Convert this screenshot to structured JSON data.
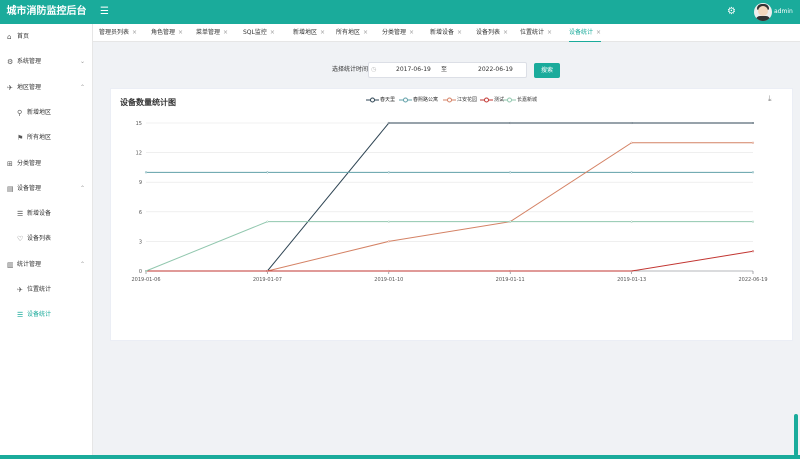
{
  "app": {
    "title": "城市消防监控后台",
    "menu_icon": "☰",
    "settings_icon": "⚙",
    "user_name": "admin"
  },
  "sidebar": {
    "items": [
      {
        "label": "首页",
        "icon": "home-icon",
        "glyph": "⌂",
        "level": 0,
        "expandable": false
      },
      {
        "label": "系统管理",
        "icon": "settings-icon",
        "glyph": "⚙",
        "level": 0,
        "expandable": true,
        "arrow": "⌄"
      },
      {
        "label": "地区管理",
        "icon": "navigation-icon",
        "glyph": "✈",
        "level": 0,
        "expandable": true,
        "arrow": "⌃"
      },
      {
        "label": "新增地区",
        "icon": "location-icon",
        "glyph": "⚲",
        "level": 1
      },
      {
        "label": "所有地区",
        "icon": "flag-icon",
        "glyph": "⚑",
        "level": 1
      },
      {
        "label": "分类管理",
        "icon": "grid-icon",
        "glyph": "⊞",
        "level": 0,
        "expandable": false
      },
      {
        "label": "设备管理",
        "icon": "document-icon",
        "glyph": "▤",
        "level": 0,
        "expandable": true,
        "arrow": "⌃"
      },
      {
        "label": "新增设备",
        "icon": "list-icon",
        "glyph": "☰",
        "level": 1
      },
      {
        "label": "设备列表",
        "icon": "heart-icon",
        "glyph": "♡",
        "level": 1
      },
      {
        "label": "统计管理",
        "icon": "chart-icon",
        "glyph": "▥",
        "level": 0,
        "expandable": true,
        "arrow": "⌃"
      },
      {
        "label": "位置统计",
        "icon": "navigation-icon",
        "glyph": "✈",
        "level": 1
      },
      {
        "label": "设备统计",
        "icon": "list-icon",
        "glyph": "☰",
        "level": 1,
        "active": true
      }
    ]
  },
  "tabs": [
    {
      "label": "管理员列表",
      "close": "×"
    },
    {
      "label": "角色管理",
      "close": "×"
    },
    {
      "label": "菜单管理",
      "close": "×"
    },
    {
      "label": "SQL监控",
      "close": "×"
    },
    {
      "label": "新增地区",
      "close": "×"
    },
    {
      "label": "所有地区",
      "close": "×"
    },
    {
      "label": "分类管理",
      "close": "×"
    },
    {
      "label": "新增设备",
      "close": "×"
    },
    {
      "label": "设备列表",
      "close": "×"
    },
    {
      "label": "位置统计",
      "close": "×"
    },
    {
      "label": "设备统计",
      "close": "×",
      "active": true
    }
  ],
  "filter": {
    "label": "选择统计时间",
    "calendar_icon": "◷",
    "start_date": "2017-06-19",
    "separator": "至",
    "end_date": "2022-06-19",
    "search_label": "搜索"
  },
  "card": {
    "title": "设备数量统计图",
    "download_icon": "⤓"
  },
  "colors": {
    "accent": "#1aab9b"
  },
  "chart_data": {
    "type": "line",
    "title": "设备数量统计图",
    "categories": [
      "2019-01-06",
      "2019-01-07",
      "2019-01-10",
      "2019-01-11",
      "2019-01-13",
      "2022-06-19"
    ],
    "ylim": [
      0,
      15
    ],
    "yticks": [
      0,
      3,
      6,
      9,
      12,
      15
    ],
    "grid": true,
    "legend_position": "top",
    "series": [
      {
        "name": "春天里",
        "color": "#2f4554",
        "values": [
          0,
          0,
          15,
          15,
          15,
          15
        ]
      },
      {
        "name": "春熙路公寓",
        "color": "#61a0a8",
        "values": [
          10,
          10,
          10,
          10,
          10,
          10
        ]
      },
      {
        "name": "江安花园",
        "color": "#d48265",
        "values": [
          0,
          0,
          3,
          5,
          13,
          13
        ]
      },
      {
        "name": "测试",
        "color": "#c23531",
        "values": [
          0,
          0,
          0,
          0,
          0,
          2
        ]
      },
      {
        "name": "长嘉新城",
        "color": "#91c7ae",
        "values": [
          0,
          5,
          5,
          5,
          5,
          5
        ]
      }
    ]
  }
}
